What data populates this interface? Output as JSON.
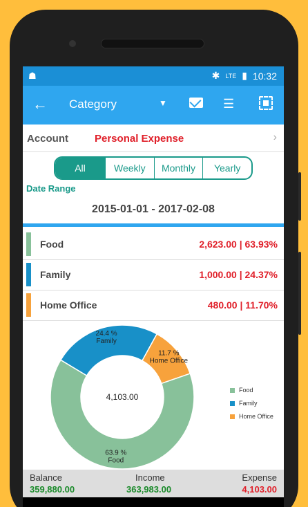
{
  "status": {
    "time": "10:32",
    "lte": "LTE"
  },
  "appbar": {
    "title": "Category"
  },
  "account": {
    "label": "Account",
    "value": "Personal Expense"
  },
  "period_tabs": [
    "All",
    "Weekly",
    "Monthly",
    "Yearly"
  ],
  "date_range": {
    "label": "Date Range",
    "value": "2015-01-01 - 2017-02-08"
  },
  "categories": [
    {
      "name": "Food",
      "amount": "2,623.00 | 63.93%",
      "color": "#88C19A"
    },
    {
      "name": "Family",
      "amount": "1,000.00 | 24.37%",
      "color": "#1890C8"
    },
    {
      "name": "Home Office",
      "amount": "480.00 | 11.70%",
      "color": "#F7A23C"
    }
  ],
  "chart_data": {
    "type": "pie",
    "center_label": "4,103.00",
    "slices": [
      {
        "name": "Food",
        "value": 63.9,
        "label": "63.9 %",
        "color": "#88C19A"
      },
      {
        "name": "Family",
        "value": 24.4,
        "label": "24.4 %",
        "color": "#1890C8"
      },
      {
        "name": "Home Office",
        "value": 11.7,
        "label": "11.7 %",
        "color": "#F7A23C"
      }
    ],
    "legend_placement": "right"
  },
  "footer": {
    "balance_label": "Balance",
    "balance": "359,880.00",
    "income_label": "Income",
    "income": "363,983.00",
    "expense_label": "Expense",
    "expense": "4,103.00"
  }
}
